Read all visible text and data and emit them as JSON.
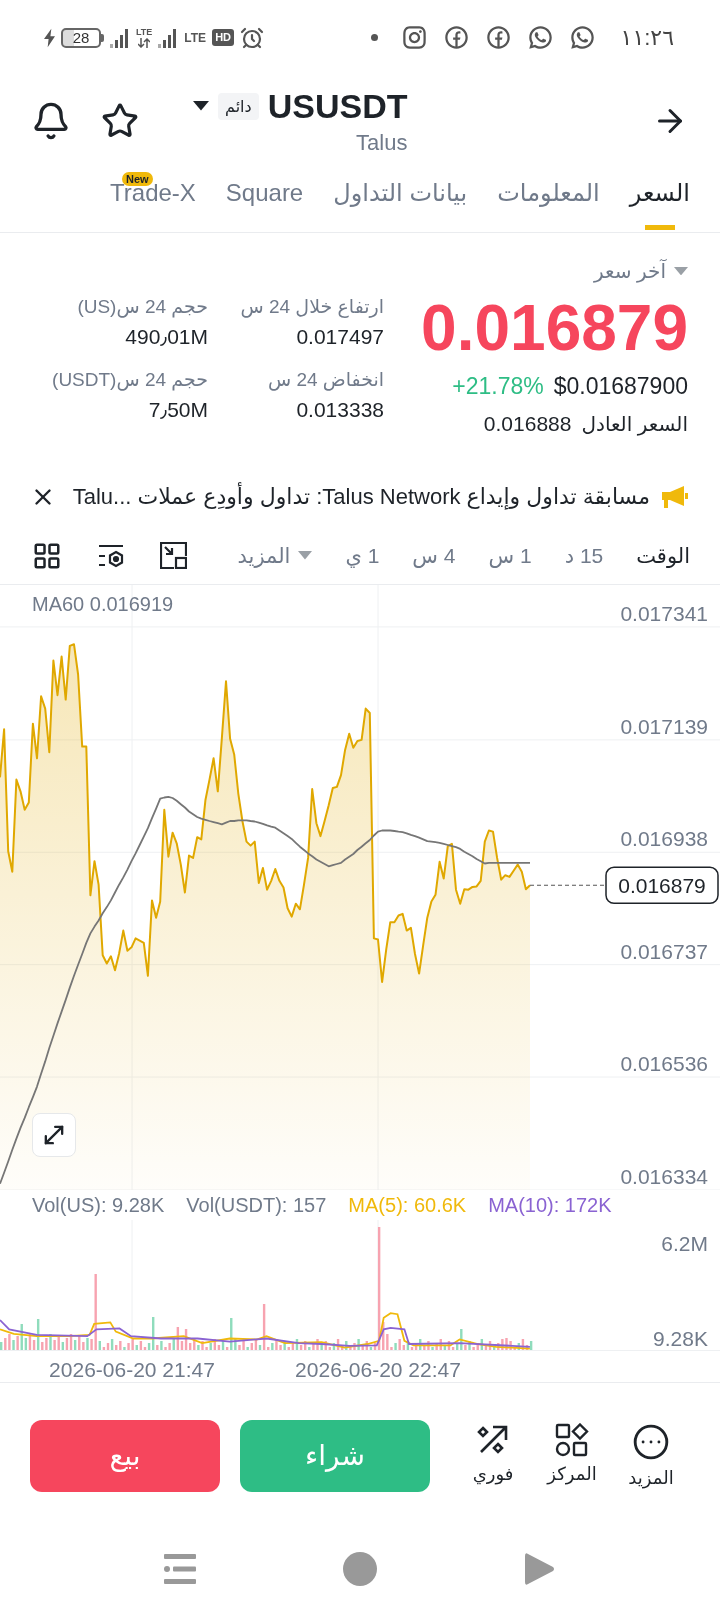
{
  "status_bar": {
    "time": "١١:٢٦",
    "battery": "28",
    "network_labels": [
      "LTE",
      "LTE"
    ],
    "hd_label": "HD"
  },
  "header": {
    "symbol": "USUSDT",
    "contract_badge": "دائم",
    "subtitle": "Talus"
  },
  "tabs": [
    {
      "label": "السعر",
      "selected": true
    },
    {
      "label": "المعلومات",
      "selected": false
    },
    {
      "label": "بيانات التداول",
      "selected": false
    },
    {
      "label": "Square",
      "selected": false
    },
    {
      "label": "Trade-X",
      "selected": false,
      "badge": "New"
    }
  ],
  "price": {
    "label": "آخر سعر",
    "last": "0.016879",
    "usd": "$0.01687900",
    "change": "+21.78%",
    "fair_label": "السعر العادل",
    "fair": "0.016888"
  },
  "stats": [
    {
      "label": "ارتفاع خلال 24 س",
      "value": "0.017497"
    },
    {
      "label": "حجم 24 س(US)",
      "value": "490٫01M"
    },
    {
      "label": "انخفاض 24 س",
      "value": "0.013338"
    },
    {
      "label": "حجم 24 س(USDT)",
      "value": "7٫50M"
    }
  ],
  "announcement": {
    "text": "مسابقة تداول وإيداع Talus Network: تداول وأودِع عملات ...Talu"
  },
  "intervals": [
    {
      "label": "الوقت",
      "selected": true
    },
    {
      "label": "15 د",
      "selected": false
    },
    {
      "label": "1 س",
      "selected": false
    },
    {
      "label": "4 س",
      "selected": false
    },
    {
      "label": "1 ي",
      "selected": false
    }
  ],
  "more_intervals": "المزيد",
  "chart": {
    "ma_value": "0.016919",
    "last_price_tag": "0.016879",
    "chart_data": {
      "type": "area",
      "grid": true,
      "series": [
        {
          "color": "#e0a800",
          "values": [
            0.017072,
            0.017158,
            0.01694,
            0.016903,
            0.017068,
            0.017047,
            0.017014,
            0.017027,
            0.017168,
            0.017106,
            0.017217,
            0.017195,
            0.017117,
            0.017281,
            0.017219,
            0.017288,
            0.017211,
            0.017307,
            0.01731,
            0.017256,
            0.017127,
            0.017127,
            0.016861,
            0.016922,
            0.01688,
            0.016754,
            0.016739,
            0.016752,
            0.016727,
            0.016757,
            0.016798,
            0.016762,
            0.016768,
            0.016784,
            0.01678,
            0.016776,
            0.016717,
            0.016852,
            0.016821,
            0.01685,
            0.017014,
            0.01693,
            0.016973,
            0.016954,
            0.016916,
            0.016866,
            0.016932,
            0.016928,
            0.016965,
            0.016961,
            0.017031,
            0.017068,
            0.017106,
            0.017047,
            0.017143,
            0.017244,
            0.017141,
            0.017113,
            0.017043,
            0.016994,
            0.016957,
            0.01695,
            0.016957,
            0.016883,
            0.01691,
            0.016871,
            0.016887,
            0.016908,
            0.016887,
            0.016875,
            0.016838,
            0.016823,
            0.016846,
            0.016836,
            0.01688,
            0.016928,
            0.017051,
            0.01699,
            0.016967,
            0.016994,
            0.017022,
            0.017053,
            0.017055,
            0.017076,
            0.017121,
            0.01715,
            0.017125,
            0.017137,
            0.017139,
            0.017195,
            0.017187,
            0.016784,
            0.016782,
            0.016706,
            0.016764,
            0.016813,
            0.016813,
            0.016825,
            0.016828,
            0.016798,
            0.016803,
            0.016756,
            0.016721,
            0.016772,
            0.016821,
            0.01685,
            0.016862,
            0.016921,
            0.016891,
            0.016949,
            0.016953,
            0.016871,
            0.016846,
            0.016872,
            0.016871,
            0.016876,
            0.016877,
            0.016887,
            0.016957,
            0.016977,
            0.016975,
            0.016928,
            0.016889,
            0.016897,
            0.016894,
            0.016905,
            0.016916,
            0.016903,
            0.016872,
            0.016879
          ]
        },
        {
          "name": "MA60",
          "type": "line",
          "color": "#767676",
          "values": [
            0.016345,
            0.016365,
            0.016385,
            0.016406,
            0.016426,
            0.016445,
            0.016463,
            0.016482,
            0.0165,
            0.016519,
            0.016542,
            0.016564,
            0.016588,
            0.01661,
            0.016632,
            0.016653,
            0.016674,
            0.016696,
            0.016717,
            0.016737,
            0.016756,
            0.016776,
            0.016793,
            0.016805,
            0.016816,
            0.016829,
            0.01684,
            0.016852,
            0.016866,
            0.01688,
            0.016893,
            0.016907,
            0.016922,
            0.016936,
            0.016951,
            0.016966,
            0.016981,
            0.016999,
            0.017016,
            0.017034,
            0.017036,
            0.017037,
            0.017035,
            0.01703,
            0.017024,
            0.017018,
            0.017011,
            0.017006,
            0.017001,
            0.016998,
            0.016996,
            0.016994,
            0.016992,
            0.01699,
            0.016988,
            0.016991,
            0.016994,
            0.016994,
            0.016995,
            0.016995,
            0.016995,
            0.016994,
            0.016993,
            0.016991,
            0.016989,
            0.016986,
            0.016984,
            0.016982,
            0.016977,
            0.016972,
            0.016967,
            0.016962,
            0.016955,
            0.016948,
            0.016942,
            0.016936,
            0.016931,
            0.016925,
            0.016921,
            0.016917,
            0.016913,
            0.016915,
            0.016917,
            0.016919,
            0.016925,
            0.01693,
            0.016935,
            0.016942,
            0.016948,
            0.016954,
            0.01696,
            0.016968,
            0.016975,
            0.016977,
            0.016977,
            0.016977,
            0.016976,
            0.016975,
            0.016974,
            0.016972,
            0.016969,
            0.016967,
            0.016964,
            0.016961,
            0.016958,
            0.016957,
            0.016956,
            0.016955,
            0.016953,
            0.016951,
            0.016949,
            0.016947,
            0.016944,
            0.016939,
            0.016935,
            0.016931,
            0.016926,
            0.016922,
            0.016918,
            0.016919,
            0.016919,
            0.016919,
            0.016919,
            0.016919,
            0.016919,
            0.016919,
            0.016919,
            0.016919,
            0.016919,
            0.016919
          ]
        }
      ],
      "ylim": [
        0.016334,
        0.017416
      ],
      "yticks": [
        0.016334,
        0.016536,
        0.016737,
        0.016938,
        0.017139,
        0.017341
      ]
    }
  },
  "volume": {
    "legend": [
      {
        "label": "MA(10): 172K",
        "color": "#8a63d2"
      },
      {
        "label": "MA(5): 60.6K",
        "color": "#f0b90b"
      },
      {
        "label": "Vol(USDT): 157",
        "color": "#707a8a"
      },
      {
        "label": "Vol(US): 9.28K",
        "color": "#707a8a"
      }
    ],
    "max_label": "6.2M",
    "last_label": "9.28K",
    "time_labels": [
      "2026-06-20 22:47",
      "2026-06-20 21:47"
    ]
  },
  "actions": [
    {
      "label": "المزيد",
      "kind": "more"
    },
    {
      "label": "المركز",
      "kind": "position"
    },
    {
      "label": "فوري",
      "kind": "instant"
    }
  ],
  "trade_buttons": [
    {
      "label": "شراء",
      "kind": "buy"
    },
    {
      "label": "بيع",
      "kind": "sell"
    }
  ]
}
